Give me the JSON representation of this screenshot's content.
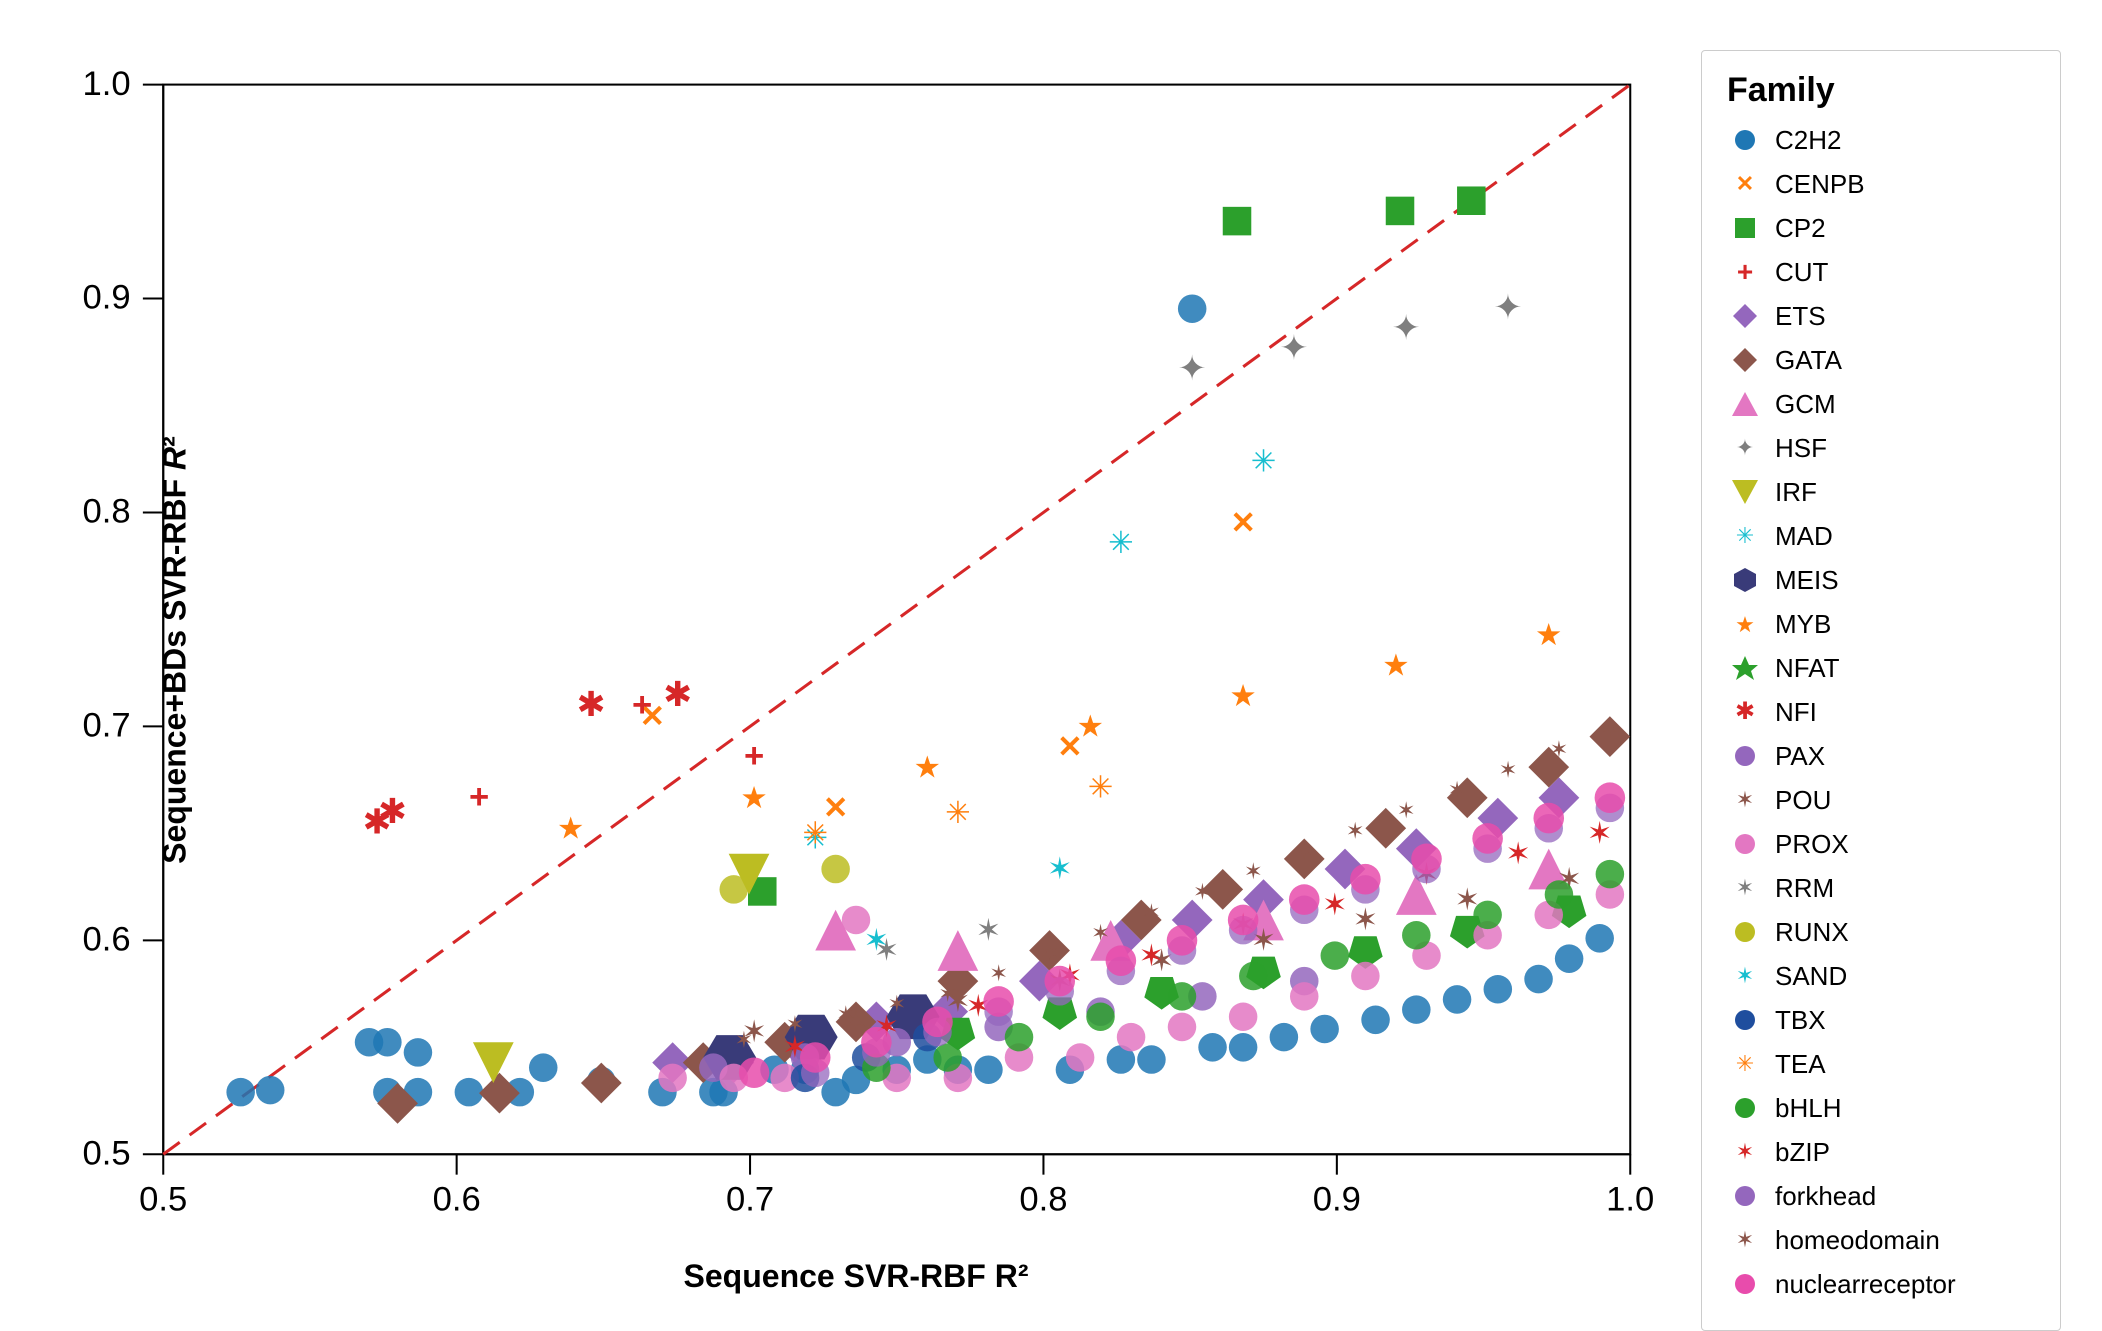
{
  "chart": {
    "title": "",
    "x_label": "Sequence SVR-RBF R²",
    "y_label": "Sequence+BDs SVR-RBF R²",
    "x_min": 0.5,
    "x_max": 1.0,
    "y_min": 0.5,
    "y_max": 1.0,
    "x_ticks": [
      0.5,
      0.6,
      0.7,
      0.8,
      0.9,
      1.0
    ],
    "y_ticks": [
      0.5,
      0.6,
      0.7,
      0.8,
      0.9,
      1.0
    ]
  },
  "legend": {
    "title": "Family",
    "items": [
      {
        "label": "C2H2",
        "color": "#1f77b4",
        "shape": "circle"
      },
      {
        "label": "CENPB",
        "color": "#ff7f0e",
        "shape": "cross"
      },
      {
        "label": "CP2",
        "color": "#2ca02c",
        "shape": "square"
      },
      {
        "label": "CUT",
        "color": "#d62728",
        "shape": "plus"
      },
      {
        "label": "ETS",
        "color": "#9467bd",
        "shape": "diamond"
      },
      {
        "label": "GATA",
        "color": "#8c564b",
        "shape": "diamond_filled"
      },
      {
        "label": "GCM",
        "color": "#e377c2",
        "shape": "triangle_up"
      },
      {
        "label": "HSF",
        "color": "#7f7f7f",
        "shape": "star4"
      },
      {
        "label": "IRF",
        "color": "#bcbd22",
        "shape": "triangle_down"
      },
      {
        "label": "MAD",
        "color": "#17becf",
        "shape": "star6"
      },
      {
        "label": "MEIS",
        "color": "#393b79",
        "shape": "hexagon"
      },
      {
        "label": "MYB",
        "color": "#ff7f0e",
        "shape": "star5"
      },
      {
        "label": "NFAT",
        "color": "#2ca02c",
        "shape": "pentagon"
      },
      {
        "label": "NFI",
        "color": "#d62728",
        "shape": "star8"
      },
      {
        "label": "PAX",
        "color": "#9467bd",
        "shape": "circle"
      },
      {
        "label": "POU",
        "color": "#8c564b",
        "shape": "star6"
      },
      {
        "label": "PROX",
        "color": "#e377c2",
        "shape": "circle"
      },
      {
        "label": "RRM",
        "color": "#7f7f7f",
        "shape": "star6"
      },
      {
        "label": "RUNX",
        "color": "#bcbd22",
        "shape": "circle"
      },
      {
        "label": "SAND",
        "color": "#17becf",
        "shape": "star6"
      },
      {
        "label": "TBX",
        "color": "#1f4e9e",
        "shape": "circle"
      },
      {
        "label": "TEA",
        "color": "#ff7f0e",
        "shape": "star8"
      },
      {
        "label": "bHLH",
        "color": "#2ca02c",
        "shape": "circle"
      },
      {
        "label": "bZIP",
        "color": "#d62728",
        "shape": "star6"
      },
      {
        "label": "forkhead",
        "color": "#9467bd",
        "shape": "circle"
      },
      {
        "label": "homeodomain",
        "color": "#8c564b",
        "shape": "star6"
      },
      {
        "label": "nuclearreceptor",
        "color": "#e377c2",
        "shape": "circle"
      }
    ]
  }
}
